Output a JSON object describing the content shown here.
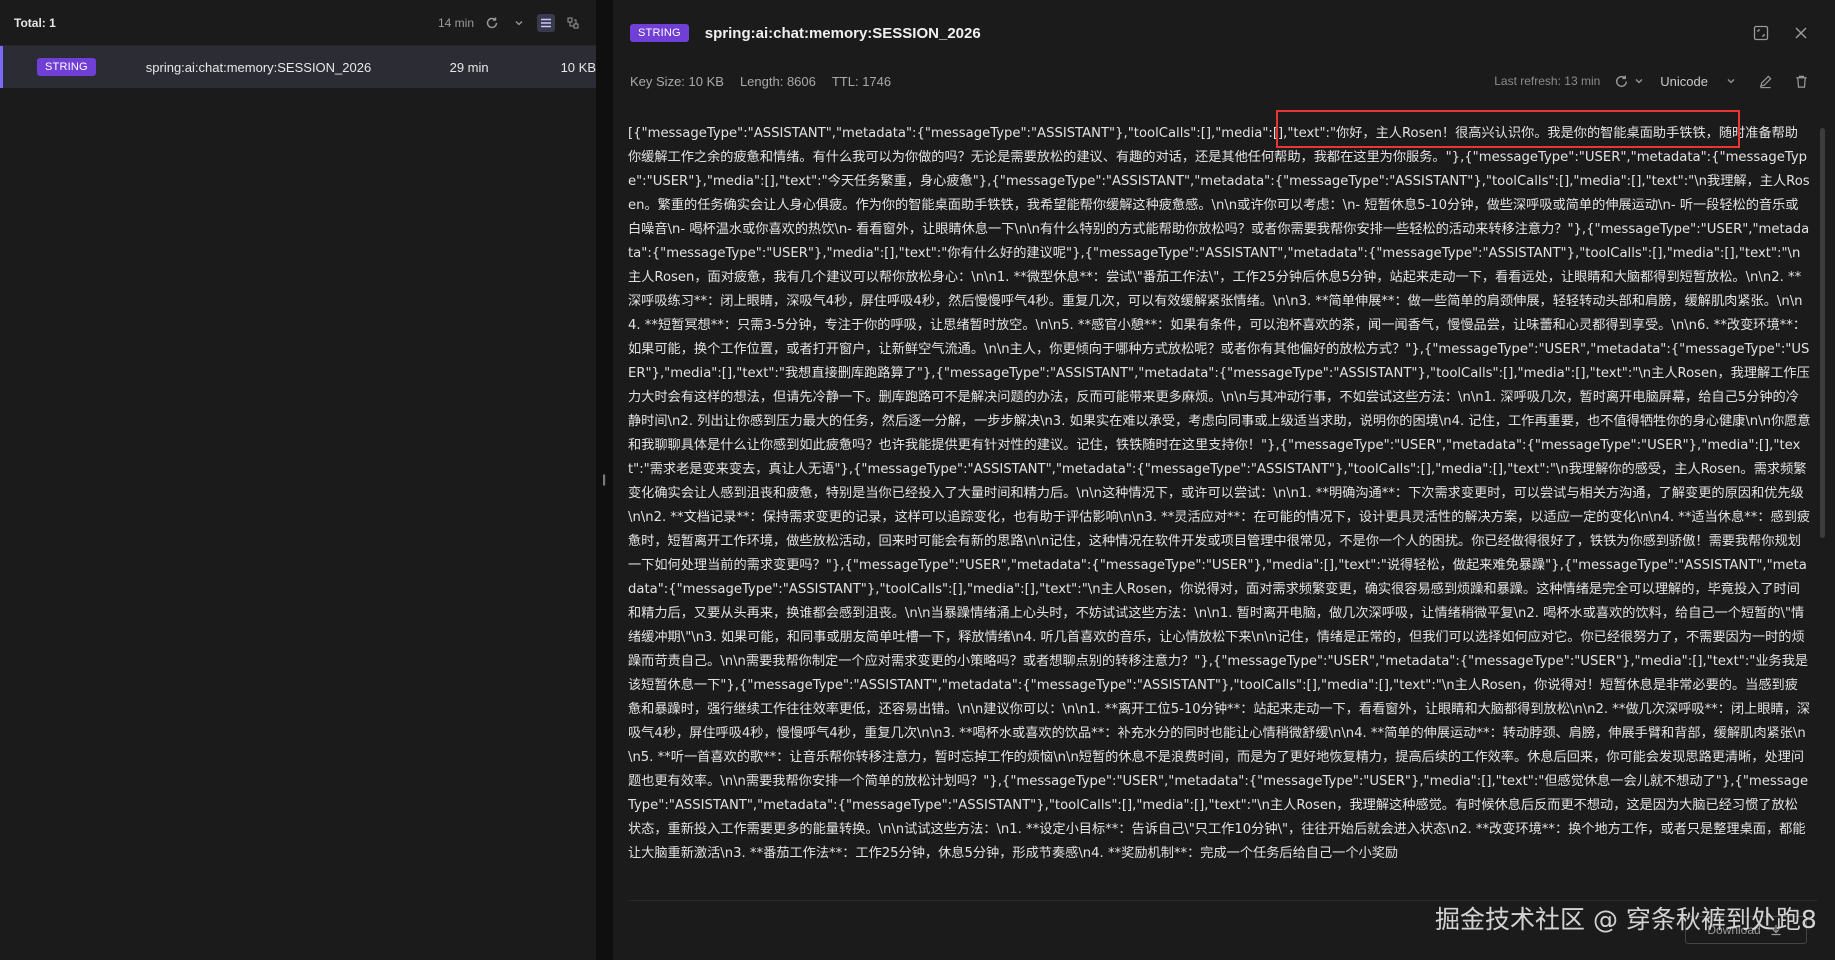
{
  "browser": {
    "total_label": "Total: 1",
    "ttl_filter": "14 min"
  },
  "key_list": [
    {
      "type": "STRING",
      "name": "spring:ai:chat:memory:SESSION_2026",
      "ttl": "29 min",
      "size": "10 KB"
    }
  ],
  "detail": {
    "type": "STRING",
    "key_name": "spring:ai:chat:memory:SESSION_2026",
    "key_size": "Key Size: 10 KB",
    "length": "Length: 8606",
    "ttl": "TTL:  1746",
    "last_refresh": "Last refresh: 13 min",
    "format": "Unicode",
    "value": "[{\"messageType\":\"ASSISTANT\",\"metadata\":{\"messageType\":\"ASSISTANT\"},\"toolCalls\":[],\"media\":[],\"text\":\"你好，主人Rosen！很高兴认识你。我是你的智能桌面助手铁铁，随时准备帮助你缓解工作之余的疲惫和情绪。有什么我可以为你做的吗？无论是需要放松的建议、有趣的对话，还是其他任何帮助，我都在这里为你服务。\"},{\"messageType\":\"USER\",\"metadata\":{\"messageType\":\"USER\"},\"media\":[],\"text\":\"今天任务繁重，身心疲惫\"},{\"messageType\":\"ASSISTANT\",\"metadata\":{\"messageType\":\"ASSISTANT\"},\"toolCalls\":[],\"media\":[],\"text\":\"\\n我理解，主人Rosen。繁重的任务确实会让人身心俱疲。作为你的智能桌面助手铁铁，我希望能帮你缓解这种疲惫感。\\n\\n或许你可以考虑：\\n- 短暂休息5-10分钟，做些深呼吸或简单的伸展运动\\n- 听一段轻松的音乐或白噪音\\n- 喝杯温水或你喜欢的热饮\\n- 看看窗外，让眼睛休息一下\\n\\n有什么特别的方式能帮助你放松吗？或者你需要我帮你安排一些轻松的活动来转移注意力？\"},{\"messageType\":\"USER\",\"metadata\":{\"messageType\":\"USER\"},\"media\":[],\"text\":\"你有什么好的建议呢\"},{\"messageType\":\"ASSISTANT\",\"metadata\":{\"messageType\":\"ASSISTANT\"},\"toolCalls\":[],\"media\":[],\"text\":\"\\n主人Rosen，面对疲惫，我有几个建议可以帮你放松身心：\\n\\n1. **微型休息**：尝试\\\"番茄工作法\\\"，工作25分钟后休息5分钟，站起来走动一下，看看远处，让眼睛和大脑都得到短暂放松。\\n\\n2. **深呼吸练习**：闭上眼睛，深吸气4秒，屏住呼吸4秒，然后慢慢呼气4秒。重复几次，可以有效缓解紧张情绪。\\n\\n3. **简单伸展**：做一些简单的肩颈伸展，轻轻转动头部和肩膀，缓解肌肉紧张。\\n\\n4. **短暂冥想**：只需3-5分钟，专注于你的呼吸，让思绪暂时放空。\\n\\n5. **感官小憩**：如果有条件，可以泡杯喜欢的茶，闻一闻香气，慢慢品尝，让味蕾和心灵都得到享受。\\n\\n6. **改变环境**：如果可能，换个工作位置，或者打开窗户，让新鲜空气流通。\\n\\n主人，你更倾向于哪种方式放松呢？或者你有其他偏好的放松方式？\"},{\"messageType\":\"USER\",\"metadata\":{\"messageType\":\"USER\"},\"media\":[],\"text\":\"我想直接删库跑路算了\"},{\"messageType\":\"ASSISTANT\",\"metadata\":{\"messageType\":\"ASSISTANT\"},\"toolCalls\":[],\"media\":[],\"text\":\"\\n主人Rosen，我理解工作压力大时会有这样的想法，但请先冷静一下。删库跑路可不是解决问题的办法，反而可能带来更多麻烦。\\n\\n与其冲动行事，不如尝试这些方法：\\n\\n1. 深呼吸几次，暂时离开电脑屏幕，给自己5分钟的冷静时间\\n2. 列出让你感到压力最大的任务，然后逐一分解，一步步解决\\n3. 如果实在难以承受，考虑向同事或上级适当求助，说明你的困境\\n4. 记住，工作再重要，也不值得牺牲你的身心健康\\n\\n你愿意和我聊聊具体是什么让你感到如此疲惫吗？也许我能提供更有针对性的建议。记住，铁铁随时在这里支持你！\"},{\"messageType\":\"USER\",\"metadata\":{\"messageType\":\"USER\"},\"media\":[],\"text\":\"需求老是变来变去，真让人无语\"},{\"messageType\":\"ASSISTANT\",\"metadata\":{\"messageType\":\"ASSISTANT\"},\"toolCalls\":[],\"media\":[],\"text\":\"\\n我理解你的感受，主人Rosen。需求频繁变化确实会让人感到沮丧和疲惫，特别是当你已经投入了大量时间和精力后。\\n\\n这种情况下，或许可以尝试：\\n\\n1. **明确沟通**：下次需求变更时，可以尝试与相关方沟通，了解变更的原因和优先级\\n\\n2. **文档记录**：保持需求变更的记录，这样可以追踪变化，也有助于评估影响\\n\\n3. **灵活应对**：在可能的情况下，设计更具灵活性的解决方案，以适应一定的变化\\n\\n4. **适当休息**：感到疲惫时，短暂离开工作环境，做些放松活动，回来时可能会有新的思路\\n\\n记住，这种情况在软件开发或项目管理中很常见，不是你一个人的困扰。你已经做得很好了，铁铁为你感到骄傲！需要我帮你规划一下如何处理当前的需求变更吗？\"},{\"messageType\":\"USER\",\"metadata\":{\"messageType\":\"USER\"},\"media\":[],\"text\":\"说得轻松，做起来难免暴躁\"},{\"messageType\":\"ASSISTANT\",\"metadata\":{\"messageType\":\"ASSISTANT\"},\"toolCalls\":[],\"media\":[],\"text\":\"\\n主人Rosen，你说得对，面对需求频繁变更，确实很容易感到烦躁和暴躁。这种情绪是完全可以理解的，毕竟投入了时间和精力后，又要从头再来，换谁都会感到沮丧。\\n\\n当暴躁情绪涌上心头时，不妨试试这些方法：\\n\\n1. 暂时离开电脑，做几次深呼吸，让情绪稍微平复\\n2. 喝杯水或喜欢的饮料，给自己一个短暂的\\\"情绪缓冲期\\\"\\n3. 如果可能，和同事或朋友简单吐槽一下，释放情绪\\n4. 听几首喜欢的音乐，让心情放松下来\\n\\n记住，情绪是正常的，但我们可以选择如何应对它。你已经很努力了，不需要因为一时的烦躁而苛责自己。\\n\\n需要我帮你制定一个应对需求变更的小策略吗？或者想聊点别的转移注意力？\"},{\"messageType\":\"USER\",\"metadata\":{\"messageType\":\"USER\"},\"media\":[],\"text\":\"业务我是该短暂休息一下\"},{\"messageType\":\"ASSISTANT\",\"metadata\":{\"messageType\":\"ASSISTANT\"},\"toolCalls\":[],\"media\":[],\"text\":\"\\n主人Rosen，你说得对！短暂休息是非常必要的。当感到疲惫和暴躁时，强行继续工作往往效率更低，还容易出错。\\n\\n建议你可以：\\n\\n1. **离开工位5-10分钟**：站起来走动一下，看看窗外，让眼睛和大脑都得到放松\\n\\n2. **做几次深呼吸**：闭上眼睛，深吸气4秒，屏住呼吸4秒，慢慢呼气4秒，重复几次\\n\\n3. **喝杯水或喜欢的饮品**：补充水分的同时也能让心情稍微舒缓\\n\\n4. **简单的伸展运动**：转动脖颈、肩膀，伸展手臂和背部，缓解肌肉紧张\\n\\n5. **听一首喜欢的歌**：让音乐帮你转移注意力，暂时忘掉工作的烦恼\\n\\n短暂的休息不是浪费时间，而是为了更好地恢复精力，提高后续的工作效率。休息后回来，你可能会发现思路更清晰，处理问题也更有效率。\\n\\n需要我帮你安排一个简单的放松计划吗？\"},{\"messageType\":\"USER\",\"metadata\":{\"messageType\":\"USER\"},\"media\":[],\"text\":\"但感觉休息一会儿就不想动了\"},{\"messageType\":\"ASSISTANT\",\"metadata\":{\"messageType\":\"ASSISTANT\"},\"toolCalls\":[],\"media\":[],\"text\":\"\\n主人Rosen，我理解这种感觉。有时候休息后反而更不想动，这是因为大脑已经习惯了放松状态，重新投入工作需要更多的能量转换。\\n\\n试试这些方法：\\n1. **设定小目标**：告诉自己\\\"只工作10分钟\\\"，往往开始后就会进入状态\\n2. **改变环境**：换个地方工作，或者只是整理桌面，都能让大脑重新激活\\n3. **番茄工作法**：工作25分钟，休息5分钟，形成节奏感\\n4. **奖励机制**：完成一个任务后给自己一个小奖励"
  },
  "footer": {
    "download_label": "Download",
    "watermark": "掘金技术社区 @ 穿条秋裤到处跑8"
  }
}
